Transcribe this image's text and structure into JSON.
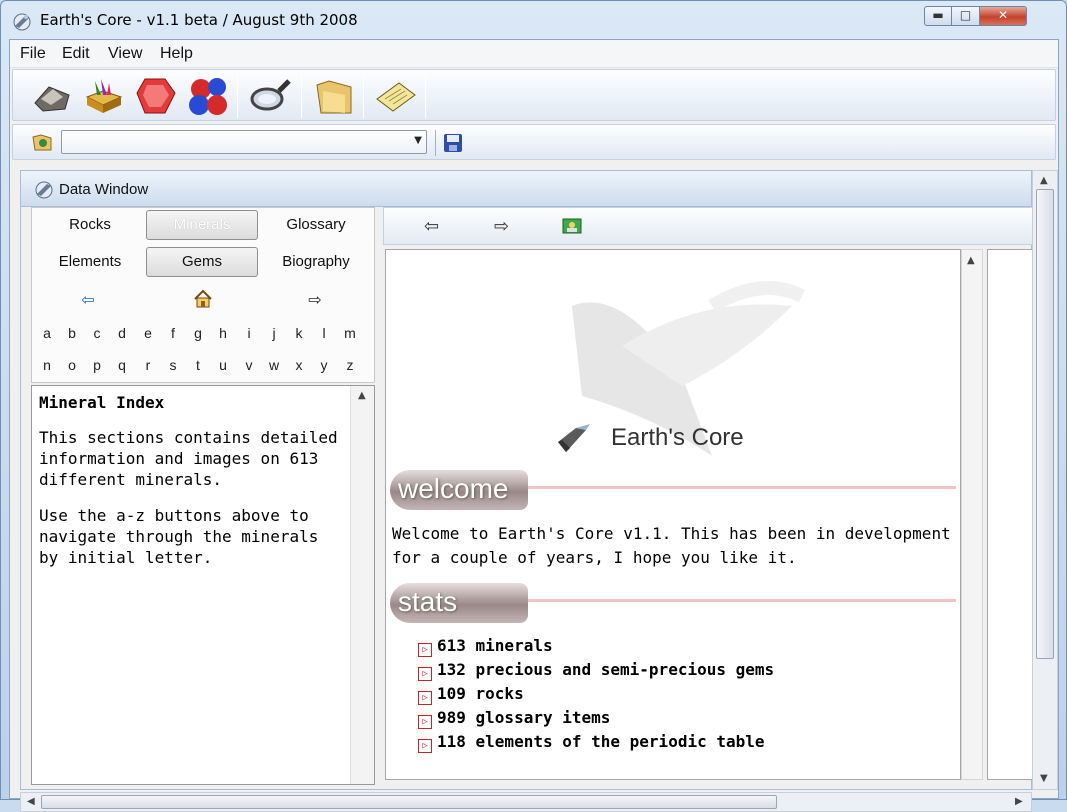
{
  "window": {
    "title": "Earth's Core - v1.1 beta / August 9th 2008",
    "min_glyph": "▬",
    "max_glyph": "□",
    "close_glyph": "✕"
  },
  "menu": [
    "File",
    "Edit",
    "View",
    "Help"
  ],
  "toolbar": {
    "tools": [
      "rocks-icon",
      "minerals-icon",
      "gems-icon",
      "elements-icon",
      "magnifier-icon",
      "folder-icon",
      "notes-icon"
    ]
  },
  "data_window": {
    "title": "Data Window"
  },
  "nav": {
    "buttons": [
      {
        "label": "Rocks",
        "selected": false
      },
      {
        "label": "Minerals",
        "selected": true
      },
      {
        "label": "Glossary",
        "selected": false
      },
      {
        "label": "Elements",
        "selected": false
      },
      {
        "label": "Gems",
        "selected": true
      },
      {
        "label": "Biography",
        "selected": false
      }
    ],
    "letters_row1": [
      "a",
      "b",
      "c",
      "d",
      "e",
      "f",
      "g",
      "h",
      "i",
      "j",
      "k",
      "l",
      "m"
    ],
    "letters_row2": [
      "n",
      "o",
      "p",
      "q",
      "r",
      "s",
      "t",
      "u",
      "v",
      "w",
      "x",
      "y",
      "z"
    ]
  },
  "index": {
    "heading": "Mineral Index",
    "para1": "This sections contains detailed information and images on 613 different minerals.",
    "para2": "Use the a-z buttons above to navigate through the minerals by initial letter."
  },
  "web": {
    "logo_text": "Earth's Core",
    "welcome_banner": "welcome",
    "welcome_text": "Welcome to Earth's Core v1.1. This has been in development for a couple of years, I hope you like it.",
    "stats_banner": "stats",
    "stats": [
      "613 minerals",
      "132 precious and semi-precious gems",
      "109 rocks",
      "989 glossary items",
      "118 elements of the periodic table"
    ]
  },
  "colors": {
    "titlebar": "#dbe8f6",
    "close_button": "#c4432d",
    "banner_line": "#f3c4c4",
    "bullet_red": "#cc2222"
  }
}
